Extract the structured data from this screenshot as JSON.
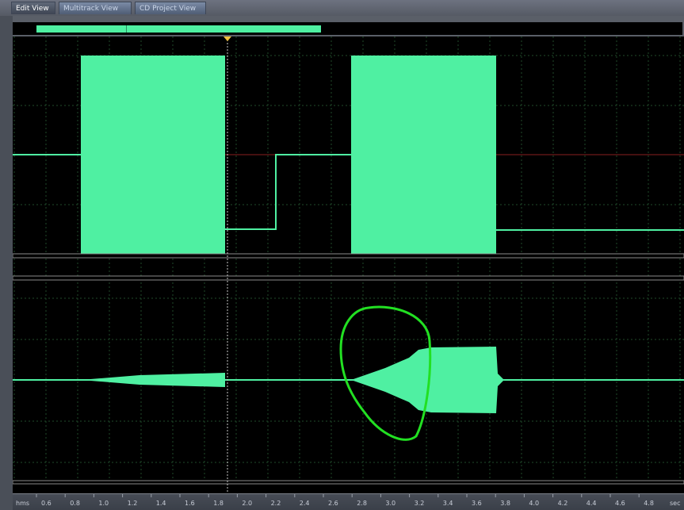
{
  "tabs": [
    {
      "label": "Edit View",
      "active": true
    },
    {
      "label": "Multitrack View",
      "active": false
    },
    {
      "label": "CD Project View",
      "active": false
    }
  ],
  "colors": {
    "waveform": "#4ff0a2",
    "background": "#000000",
    "grid": "#1f4a2a",
    "centerline_top": "#8a2020",
    "annotation": "#22e022"
  },
  "ruler": {
    "unit_label": "hms",
    "end_label": "sec",
    "ticks": [
      "0.6",
      "0.8",
      "1.0",
      "1.2",
      "1.4",
      "1.6",
      "1.8",
      "2.0",
      "2.2",
      "2.4",
      "2.6",
      "2.8",
      "3.0",
      "3.2",
      "3.4",
      "3.6",
      "3.8",
      "4.0",
      "4.2",
      "4.4",
      "4.6",
      "4.8"
    ]
  },
  "overview": {
    "visible_start_fraction": 0.035,
    "visible_end_fraction": 0.46
  },
  "annotation": {
    "shape": "circle",
    "note_icon": "freehand-ellipse-icon"
  }
}
